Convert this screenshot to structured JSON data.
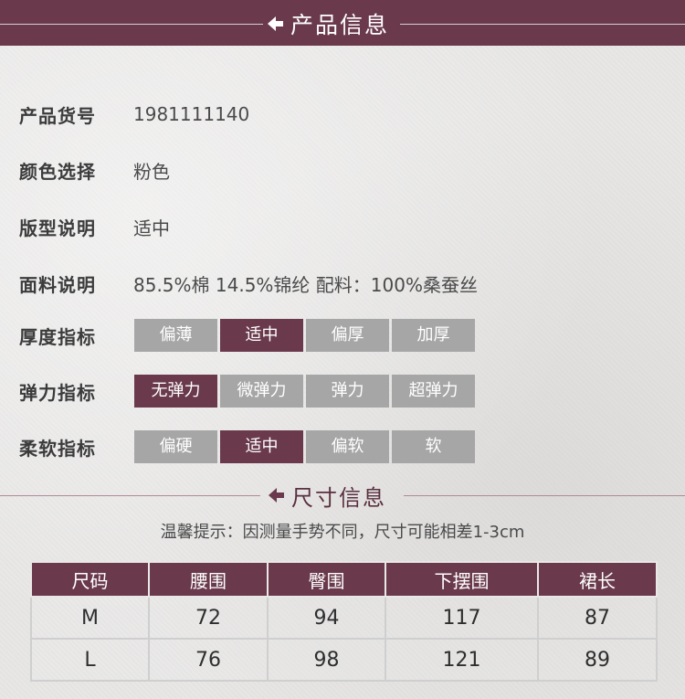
{
  "header": {
    "title": "产品信息",
    "icon": "arrow-left-icon"
  },
  "info": [
    {
      "label": "产品货号",
      "value": "1981111140"
    },
    {
      "label": "颜色选择",
      "value": "粉色"
    },
    {
      "label": "版型说明",
      "value": "适中"
    },
    {
      "label": "面料说明",
      "value": "85.5%棉 14.5%锦纶 配料：100%桑蚕丝"
    }
  ],
  "scales": [
    {
      "label": "厚度指标",
      "options": [
        "偏薄",
        "适中",
        "偏厚",
        "加厚"
      ],
      "selected": 1
    },
    {
      "label": "弹力指标",
      "options": [
        "无弹力",
        "微弹力",
        "弹力",
        "超弹力"
      ],
      "selected": 0
    },
    {
      "label": "柔软指标",
      "options": [
        "偏硬",
        "适中",
        "偏软",
        "软"
      ],
      "selected": 1
    }
  ],
  "size_section": {
    "title": "尺寸信息",
    "tip": "温馨提示：因测量手势不同，尺寸可能相差1-3cm"
  },
  "size_table": {
    "headers": [
      "尺码",
      "腰围",
      "臀围",
      "下摆围",
      "裙长"
    ],
    "rows": [
      [
        "M",
        "72",
        "94",
        "117",
        "87"
      ],
      [
        "L",
        "76",
        "98",
        "121",
        "89"
      ]
    ]
  },
  "colors": {
    "accent": "#6a3a4c",
    "option_gray": "#a6a6a6",
    "background": "#e9e8e7"
  }
}
